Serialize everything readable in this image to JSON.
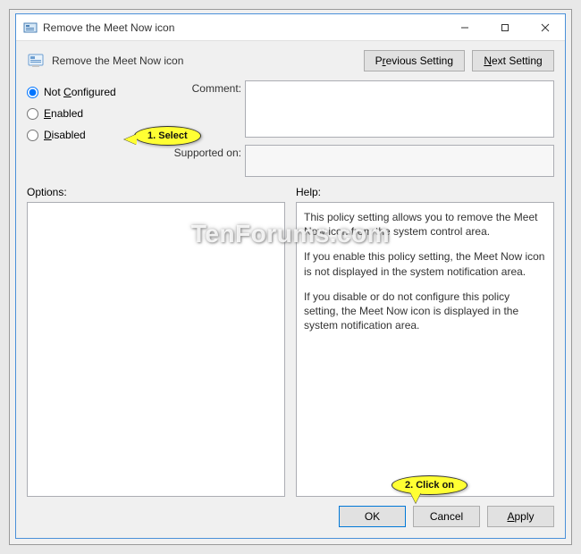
{
  "window": {
    "title": "Remove the Meet Now icon"
  },
  "header": {
    "setting_title": "Remove the Meet Now icon",
    "prev_label_pre": "P",
    "prev_label_u": "r",
    "prev_label_post": "evious Setting",
    "next_label_u": "N",
    "next_label_post": "ext Setting"
  },
  "radios": {
    "not_configured_pre": "Not ",
    "not_configured_u": "C",
    "not_configured_post": "onfigured",
    "enabled_u": "E",
    "enabled_post": "nabled",
    "disabled_u": "D",
    "disabled_post": "isabled"
  },
  "fields": {
    "comment_label": "Comment:",
    "supported_label": "Supported on:",
    "comment_value": "",
    "supported_value": ""
  },
  "lower": {
    "options_label": "Options:",
    "help_label": "Help:",
    "help_p1": "This policy setting allows you to remove the Meet Now icon from the system control area.",
    "help_p2": "If you enable this policy setting, the Meet Now icon is not displayed in the system notification area.",
    "help_p3": "If you disable or do not configure this policy setting, the Meet Now icon is displayed in the system notification area."
  },
  "buttons": {
    "ok": "OK",
    "cancel": "Cancel",
    "apply_u": "A",
    "apply_post": "pply"
  },
  "annotations": {
    "select": "1. Select",
    "click": "2. Click on"
  },
  "watermark": "TenForums.com"
}
